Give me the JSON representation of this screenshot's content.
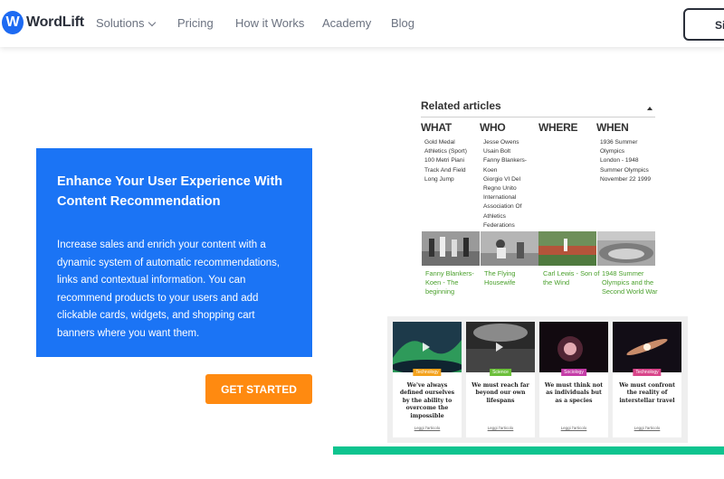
{
  "brand": {
    "logo_letter": "W",
    "name": "WordLift",
    "accent": "#1d6af2"
  },
  "nav": {
    "items": [
      {
        "label": "Solutions",
        "dropdown": true
      },
      {
        "label": "Pricing"
      },
      {
        "label": "How it Works"
      },
      {
        "label": "Academy"
      },
      {
        "label": "Blog"
      }
    ],
    "cta_partial": "Si"
  },
  "hero": {
    "heading": "Enhance Your User Experience With Content Recommendation",
    "body": "Increase sales and enrich your content with a dynamic system of automatic recommendations, links and contextual information. You can recommend products to your users and add clickable cards, widgets, and shopping cart banners where you want them.",
    "card_color": "#1b74f5",
    "button_label": "GET STARTED",
    "button_color": "#ff8a10"
  },
  "related": {
    "title": "Related articles",
    "columns": [
      {
        "head": "WHAT",
        "items": [
          "Gold Medal",
          "Athletics (Sport)",
          "100 Metri Piani",
          "Track And Field",
          "Long Jump"
        ]
      },
      {
        "head": "WHO",
        "items": [
          "Jesse Owens",
          "Usain Bolt",
          "Fanny Blankers-",
          "Koen",
          "Giorgio VI Del",
          "Regno Unito",
          "International",
          "Association Of",
          "Athletics",
          "Federations"
        ]
      },
      {
        "head": "WHERE",
        "items": []
      },
      {
        "head": "WHEN",
        "items": [
          "1936 Summer",
          "Olympics",
          "London - 1948",
          "Summer Olympics",
          "November 22 1999"
        ]
      }
    ],
    "articles": [
      {
        "caption": "Fanny Blankers-Koen - The beginning"
      },
      {
        "caption": "The Flying Housewife"
      },
      {
        "caption": "Carl Lewis - Son of the Wind"
      },
      {
        "caption": "1948 Summer Olympics and the Second World War"
      }
    ],
    "caption_color": "#4aa02c"
  },
  "widget": {
    "cards": [
      {
        "tag": "Technology",
        "tag_color": "#f4a21d",
        "title": "We've always defined ourselves by the ability to overcome the impossible",
        "link": "Leggi l'articolo"
      },
      {
        "tag": "Science",
        "tag_color": "#6bbf3a",
        "title": "We must reach far beyond our own lifespans",
        "link": "Leggi l'articolo"
      },
      {
        "tag": "Sociology",
        "tag_color": "#c53da8",
        "title": "We must think not as individuals but as a species",
        "link": "Leggi l'articolo"
      },
      {
        "tag": "Technology",
        "tag_color": "#d9458a",
        "title": "We must confront the reality of interstellar travel",
        "link": "Leggi l'articolo"
      }
    ]
  },
  "footer_bar_color": "#0ec48f"
}
